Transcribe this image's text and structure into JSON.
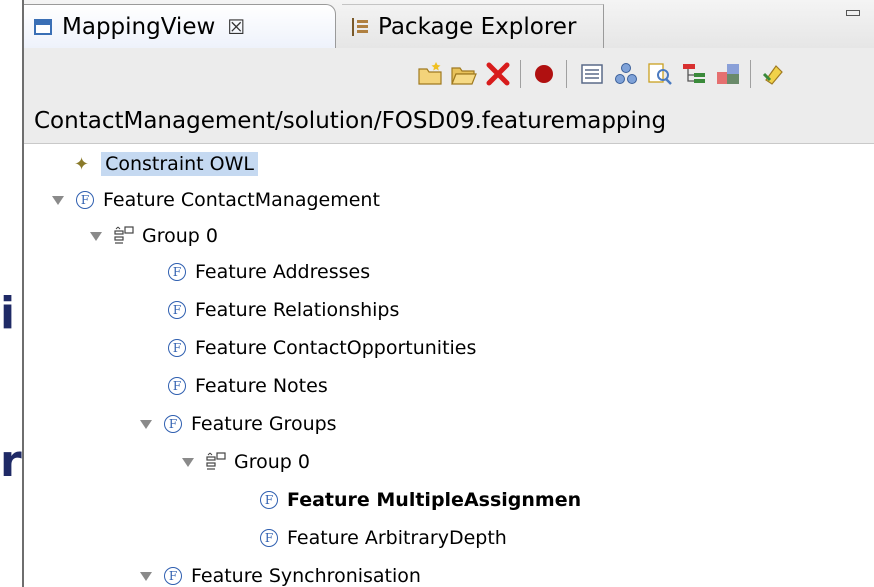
{
  "slide_fragments": [
    "i",
    "r"
  ],
  "tabs": [
    {
      "label": "MappingView",
      "close": "☒",
      "icon": "view-icon",
      "active": true
    },
    {
      "label": "Package Explorer",
      "icon": "package-explorer-icon",
      "active": false
    }
  ],
  "toolbar": {
    "buttons": [
      "new-folder-icon",
      "open-folder-icon",
      "delete-icon",
      "record-icon",
      "list-view-icon",
      "hierarchy-icon",
      "find-icon",
      "tree-layout-icon",
      "color-map-icon",
      "sync-icon"
    ]
  },
  "path": "ContactManagement/solution/FOSD09.featuremapping",
  "tree": {
    "items": [
      {
        "label": "Constraint OWL",
        "type": "constraint"
      },
      {
        "label": "Feature ContactManagement",
        "type": "feature"
      },
      {
        "label": "Group 0",
        "type": "group"
      },
      {
        "label": "Feature Addresses",
        "type": "feature"
      },
      {
        "label": "Feature Relationships",
        "type": "feature"
      },
      {
        "label": "Feature ContactOpportunities",
        "type": "feature"
      },
      {
        "label": "Feature Notes",
        "type": "feature"
      },
      {
        "label": "Feature Groups",
        "type": "feature"
      },
      {
        "label": "Group 0",
        "type": "group"
      },
      {
        "label": "Feature MultipleAssignmen",
        "type": "feature"
      },
      {
        "label": "Feature ArbitraryDepth",
        "type": "feature"
      },
      {
        "label": "Feature Synchronisation",
        "type": "feature"
      }
    ]
  },
  "colors": {
    "selection": "#c5d9f1",
    "feature_icon": "#2f5fb0",
    "slide_text": "#1f2a66"
  }
}
